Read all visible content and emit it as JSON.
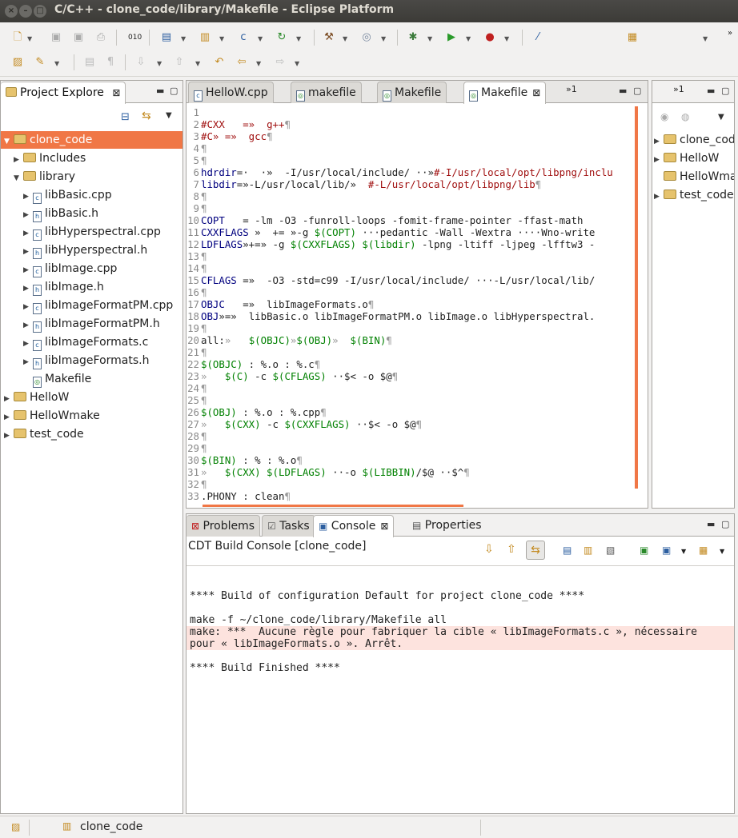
{
  "window": {
    "title": "C/C++ - clone_code/library/Makefile - Eclipse Platform"
  },
  "explorer": {
    "tab_label": "Project Explore",
    "items": [
      {
        "label": "clone_code",
        "depth": 0,
        "kind": "project",
        "twisty": "expanded",
        "selected": true
      },
      {
        "label": "Includes",
        "depth": 1,
        "kind": "includes",
        "twisty": "collapsed"
      },
      {
        "label": "library",
        "depth": 1,
        "kind": "folder",
        "twisty": "expanded"
      },
      {
        "label": "libBasic.cpp",
        "depth": 2,
        "kind": "c",
        "twisty": "collapsed"
      },
      {
        "label": "libBasic.h",
        "depth": 2,
        "kind": "h",
        "twisty": "collapsed"
      },
      {
        "label": "libHyperspectral.cpp",
        "depth": 2,
        "kind": "c",
        "twisty": "collapsed"
      },
      {
        "label": "libHyperspectral.h",
        "depth": 2,
        "kind": "h",
        "twisty": "collapsed"
      },
      {
        "label": "libImage.cpp",
        "depth": 2,
        "kind": "c",
        "twisty": "collapsed"
      },
      {
        "label": "libImage.h",
        "depth": 2,
        "kind": "h",
        "twisty": "collapsed"
      },
      {
        "label": "libImageFormatPM.cpp",
        "depth": 2,
        "kind": "c",
        "twisty": "collapsed"
      },
      {
        "label": "libImageFormatPM.h",
        "depth": 2,
        "kind": "h",
        "twisty": "collapsed"
      },
      {
        "label": "libImageFormats.c",
        "depth": 2,
        "kind": "c",
        "twisty": "collapsed"
      },
      {
        "label": "libImageFormats.h",
        "depth": 2,
        "kind": "h",
        "twisty": "collapsed"
      },
      {
        "label": "Makefile",
        "depth": 2,
        "kind": "make",
        "twisty": "none"
      },
      {
        "label": "HelloW",
        "depth": 0,
        "kind": "project",
        "twisty": "collapsed"
      },
      {
        "label": "HelloWmake",
        "depth": 0,
        "kind": "project",
        "twisty": "collapsed"
      },
      {
        "label": "test_code",
        "depth": 0,
        "kind": "project",
        "twisty": "collapsed"
      }
    ]
  },
  "editor": {
    "tabs": [
      {
        "label": "HelloW.cpp",
        "active": false
      },
      {
        "label": "makefile",
        "active": false
      },
      {
        "label": "Makefile",
        "active": false
      },
      {
        "label": "Makefile",
        "active": true
      }
    ],
    "overflow_label": "»1",
    "lines": [
      [
        [
          "",
          "#222"
        ]
      ],
      [
        [
          "#CXX",
          "#a01010"
        ],
        [
          "   =»  ",
          "#a01010"
        ],
        [
          "g++",
          "#a01010"
        ],
        [
          "¶",
          "#999"
        ]
      ],
      [
        [
          "#C» =»  gcc",
          "#a01010"
        ],
        [
          "¶",
          "#999"
        ]
      ],
      [
        [
          "¶",
          "#999"
        ]
      ],
      [
        [
          "¶",
          "#999"
        ]
      ],
      [
        [
          "hdrdir",
          "#00007f"
        ],
        [
          "=·  ·»  -I/usr/local/include/ ··»",
          "#222"
        ],
        [
          "#-I/usr/local/opt/libpng/inclu",
          "#a01010"
        ]
      ],
      [
        [
          "libdir",
          "#00007f"
        ],
        [
          "=»-L/usr/local/lib/»  ",
          "#222"
        ],
        [
          "#-L/usr/local/opt/libpng/lib",
          "#a01010"
        ],
        [
          "¶",
          "#999"
        ]
      ],
      [
        [
          "¶",
          "#999"
        ]
      ],
      [
        [
          "¶",
          "#999"
        ]
      ],
      [
        [
          "COPT",
          "#00007f"
        ],
        [
          "   = -lm -O3 -funroll-loops -fomit-frame-pointer -ffast-math",
          "#222"
        ]
      ],
      [
        [
          "CXXFLAGS",
          "#00007f"
        ],
        [
          " »  += »-g ",
          "#222"
        ],
        [
          "$(COPT)",
          "#008000"
        ],
        [
          " ···pedantic -Wall -Wextra ····Wno-write",
          "#222"
        ]
      ],
      [
        [
          "LDFLAGS",
          "#00007f"
        ],
        [
          "»+=» -g ",
          "#222"
        ],
        [
          "$(CXXFLAGS) $(libdir)",
          "#008000"
        ],
        [
          " -lpng -ltiff -ljpeg -lfftw3 -",
          "#222"
        ]
      ],
      [
        [
          "¶",
          "#999"
        ]
      ],
      [
        [
          "¶",
          "#999"
        ]
      ],
      [
        [
          "CFLAGS",
          "#00007f"
        ],
        [
          " =»  -O3 -std=c99 -I/usr/local/include/ ···-L/usr/local/lib/",
          "#222"
        ]
      ],
      [
        [
          "¶",
          "#999"
        ]
      ],
      [
        [
          "OBJC",
          "#00007f"
        ],
        [
          "   =»  libImageFormats.o",
          "#222"
        ],
        [
          "¶",
          "#999"
        ]
      ],
      [
        [
          "OBJ",
          "#00007f"
        ],
        [
          "»=»  libBasic.o libImageFormatPM.o libImage.o libHyperspectral.",
          "#222"
        ]
      ],
      [
        [
          "¶",
          "#999"
        ]
      ],
      [
        [
          "all:",
          "#222"
        ],
        [
          "»   ",
          "#999"
        ],
        [
          "$(OBJC)",
          "#008000"
        ],
        [
          "»",
          "#999"
        ],
        [
          "$(OBJ)",
          "#008000"
        ],
        [
          "»  ",
          "#999"
        ],
        [
          "$(BIN)",
          "#008000"
        ],
        [
          "¶",
          "#999"
        ]
      ],
      [
        [
          "¶",
          "#999"
        ]
      ],
      [
        [
          "$(OBJC)",
          "#008000"
        ],
        [
          " : %.o : %.c",
          "#222"
        ],
        [
          "¶",
          "#999"
        ]
      ],
      [
        [
          "»   ",
          "#999"
        ],
        [
          "$(C)",
          "#008000"
        ],
        [
          " -c ",
          "#222"
        ],
        [
          "$(CFLAGS)",
          "#008000"
        ],
        [
          " ··$< -o $@",
          "#222"
        ],
        [
          "¶",
          "#999"
        ]
      ],
      [
        [
          "¶",
          "#999"
        ]
      ],
      [
        [
          "¶",
          "#999"
        ]
      ],
      [
        [
          "$(OBJ)",
          "#008000"
        ],
        [
          " : %.o : %.cpp",
          "#222"
        ],
        [
          "¶",
          "#999"
        ]
      ],
      [
        [
          "»   ",
          "#999"
        ],
        [
          "$(CXX)",
          "#008000"
        ],
        [
          " -c ",
          "#222"
        ],
        [
          "$(CXXFLAGS)",
          "#008000"
        ],
        [
          " ··$< -o $@",
          "#222"
        ],
        [
          "¶",
          "#999"
        ]
      ],
      [
        [
          "¶",
          "#999"
        ]
      ],
      [
        [
          "¶",
          "#999"
        ]
      ],
      [
        [
          "$(BIN)",
          "#008000"
        ],
        [
          " : % : %.o",
          "#222"
        ],
        [
          "¶",
          "#999"
        ]
      ],
      [
        [
          "»   ",
          "#999"
        ],
        [
          "$(CXX) $(LDFLAGS)",
          "#008000"
        ],
        [
          " ··-o ",
          "#222"
        ],
        [
          "$(LIBBIN)",
          "#008000"
        ],
        [
          "/$@ ··$^",
          "#222"
        ],
        [
          "¶",
          "#999"
        ]
      ],
      [
        [
          "¶",
          "#999"
        ]
      ],
      [
        [
          ".PHONY : clean",
          "#222"
        ],
        [
          "¶",
          "#999"
        ]
      ]
    ]
  },
  "outline": {
    "tab_label": "»1",
    "items": [
      {
        "label": "clone_cod"
      },
      {
        "label": "HelloW"
      },
      {
        "label": "HelloWma"
      },
      {
        "label": "test_code"
      }
    ]
  },
  "bottom": {
    "tabs": [
      {
        "label": "Problems",
        "active": false
      },
      {
        "label": "Tasks",
        "active": false
      },
      {
        "label": "Console",
        "active": true
      },
      {
        "label": "Properties",
        "active": false
      }
    ],
    "console_title": "CDT Build Console [clone_code]",
    "output": [
      {
        "text": "",
        "error": false
      },
      {
        "text": "**** Build of configuration Default for project clone_code ****",
        "error": false
      },
      {
        "text": "",
        "error": false
      },
      {
        "text": "make -f ~/clone_code/library/Makefile all",
        "error": false
      },
      {
        "text": "make: ***  Aucune règle pour fabriquer la cible « libImageFormats.c », nécessaire",
        "error": true
      },
      {
        "text": "pour « libImageFormats.o ». Arrêt.",
        "error": true
      },
      {
        "text": "",
        "error": false
      },
      {
        "text": "**** Build Finished ****",
        "error": false
      }
    ]
  },
  "status": {
    "project": "clone_code"
  },
  "colors": {
    "selection": "#f07746",
    "error_bg": "#fde3de",
    "keyword_green": "#008000",
    "comment_red": "#a01010"
  }
}
